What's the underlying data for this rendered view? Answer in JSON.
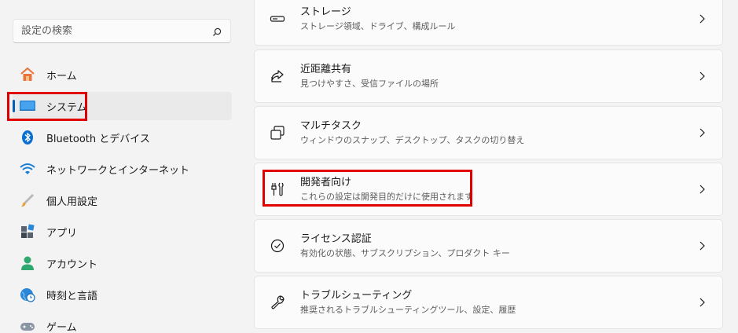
{
  "search": {
    "placeholder": "設定の検索",
    "icon": "search-icon"
  },
  "sidebar": {
    "items": [
      {
        "label": "ホーム",
        "icon": "home-icon"
      },
      {
        "label": "システム",
        "icon": "system-icon",
        "active": true
      },
      {
        "label": "Bluetooth とデバイス",
        "icon": "bluetooth-icon"
      },
      {
        "label": "ネットワークとインターネット",
        "icon": "wifi-icon"
      },
      {
        "label": "個人用設定",
        "icon": "brush-icon"
      },
      {
        "label": "アプリ",
        "icon": "apps-icon"
      },
      {
        "label": "アカウント",
        "icon": "account-icon"
      },
      {
        "label": "時刻と言語",
        "icon": "globe-clock-icon"
      },
      {
        "label": "ゲーム",
        "icon": "gamepad-icon"
      }
    ]
  },
  "main": {
    "cards": [
      {
        "title": "ストレージ",
        "desc": "ストレージ領域、ドライブ、構成ルール",
        "icon": "storage-icon"
      },
      {
        "title": "近距離共有",
        "desc": "見つけやすさ、受信ファイルの場所",
        "icon": "share-icon"
      },
      {
        "title": "マルチタスク",
        "desc": "ウィンドウのスナップ、デスクトップ、タスクの切り替え",
        "icon": "multitask-icon"
      },
      {
        "title": "開発者向け",
        "desc": "これらの設定は開発目的だけに使用されます",
        "icon": "developer-tools-icon"
      },
      {
        "title": "ライセンス認証",
        "desc": "有効化の状態、サブスクリプション、プロダクト キー",
        "icon": "activation-check-icon"
      },
      {
        "title": "トラブルシューティング",
        "desc": "推奨されるトラブルシューティングツール、設定、履歴",
        "icon": "wrench-icon"
      }
    ]
  },
  "colors": {
    "accent": "#005fb8",
    "highlight": "#e00000"
  }
}
